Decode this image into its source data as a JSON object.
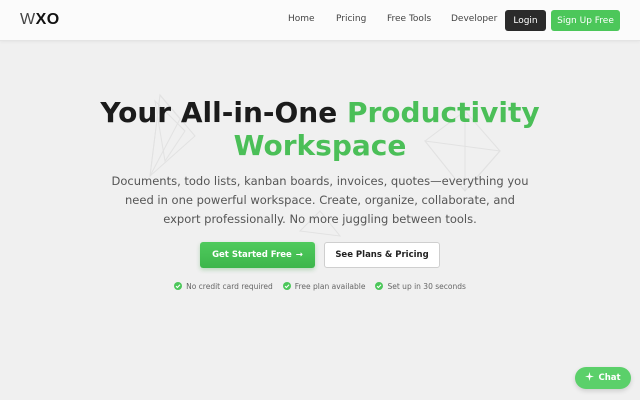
{
  "brand": {
    "logo_w": "W",
    "logo_xo": "XO"
  },
  "nav": {
    "links": [
      "Home",
      "Pricing",
      "Free Tools",
      "Developer"
    ],
    "login_label": "Login",
    "signup_label": "Sign Up Free"
  },
  "hero": {
    "title_line1_plain": "Your All-in-One ",
    "title_line1_accent": "Productivity",
    "title_line2_accent": "Workspace",
    "subtitle": "Documents, todo lists, kanban boards, invoices, quotes—everything you need in one powerful workspace. Create, organize, collaborate, and export professionally. No more juggling between tools.",
    "primary_label": "Get Started Free",
    "primary_arrow": "→",
    "secondary_label": "See Plans & Pricing",
    "features": [
      "No credit card required",
      "Free plan available",
      "Set up in 30 seconds"
    ]
  },
  "chat": {
    "label": "Chat",
    "icon": "sparkle-icon"
  },
  "colors": {
    "accent": "#4cc75a",
    "dark": "#2b2b2b",
    "background": "#f0f0f0"
  }
}
